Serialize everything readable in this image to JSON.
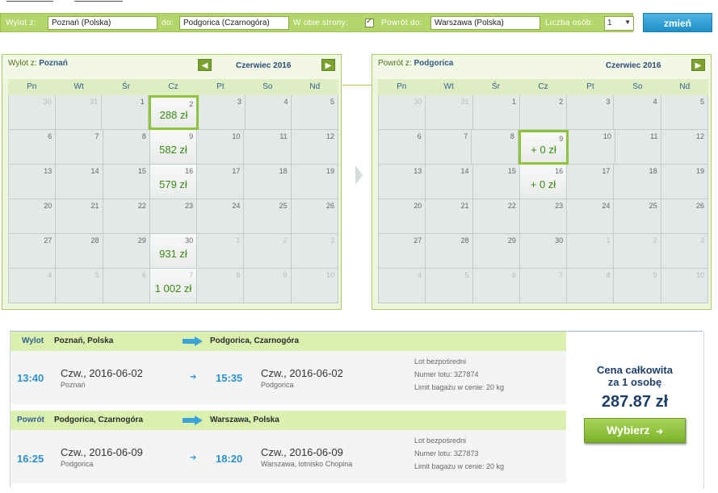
{
  "search": {
    "from_label": "Wylot z:",
    "from_value": "Poznań (Polska)",
    "to_label": "do:",
    "to_value": "Podgorica (Czarnogóra)",
    "roundtrip_label": "W obie strony:",
    "roundtrip_checked": true,
    "return_label": "Powrót do:",
    "return_value": "Warszawa (Polska)",
    "persons_label": "Liczba osób:",
    "persons_value": "1",
    "change_button": "zmień"
  },
  "calendar_out": {
    "title_prefix": "Wylot z:",
    "title_city": "Poznań",
    "month": "Czerwiec 2016",
    "prev_icon": "arrow-left-icon",
    "next_icon": "arrow-right-icon",
    "weekdays": [
      "Pn",
      "Wt",
      "Śr",
      "Cz",
      "Pt",
      "So",
      "Nd"
    ],
    "weeks": [
      [
        {
          "d": "30",
          "out": true
        },
        {
          "d": "31",
          "out": true
        },
        {
          "d": "1"
        },
        {
          "d": "2",
          "price": "288 zł",
          "avail": true,
          "selected": true
        },
        {
          "d": "3"
        },
        {
          "d": "4"
        },
        {
          "d": "5"
        }
      ],
      [
        {
          "d": "6"
        },
        {
          "d": "7"
        },
        {
          "d": "8"
        },
        {
          "d": "9",
          "price": "582 zł",
          "avail": true
        },
        {
          "d": "10"
        },
        {
          "d": "11"
        },
        {
          "d": "12"
        }
      ],
      [
        {
          "d": "13"
        },
        {
          "d": "14"
        },
        {
          "d": "15"
        },
        {
          "d": "16",
          "price": "579 zł",
          "avail": true
        },
        {
          "d": "17"
        },
        {
          "d": "18"
        },
        {
          "d": "19"
        }
      ],
      [
        {
          "d": "20"
        },
        {
          "d": "21"
        },
        {
          "d": "22"
        },
        {
          "d": "23"
        },
        {
          "d": "24"
        },
        {
          "d": "25"
        },
        {
          "d": "26"
        }
      ],
      [
        {
          "d": "27"
        },
        {
          "d": "28"
        },
        {
          "d": "29"
        },
        {
          "d": "30",
          "price": "931 zł",
          "avail": true
        },
        {
          "d": "1",
          "out": true
        },
        {
          "d": "2",
          "out": true
        },
        {
          "d": "3",
          "out": true
        }
      ],
      [
        {
          "d": "4",
          "out": true
        },
        {
          "d": "5",
          "out": true
        },
        {
          "d": "6",
          "out": true
        },
        {
          "d": "7",
          "price": "1 002 zł",
          "avail": true,
          "out": true
        },
        {
          "d": "8",
          "out": true
        },
        {
          "d": "9",
          "out": true
        },
        {
          "d": "10",
          "out": true
        }
      ]
    ]
  },
  "calendar_ret": {
    "title_prefix": "Powrót z:",
    "title_city": "Podgorica",
    "month": "Czerwiec 2016",
    "next_icon": "arrow-right-icon",
    "weekdays": [
      "Pn",
      "Wt",
      "Śr",
      "Cz",
      "Pt",
      "So",
      "Nd"
    ],
    "weeks": [
      [
        {
          "d": "30",
          "out": true
        },
        {
          "d": "31",
          "out": true
        },
        {
          "d": "1"
        },
        {
          "d": "2"
        },
        {
          "d": "3"
        },
        {
          "d": "4"
        },
        {
          "d": "5"
        }
      ],
      [
        {
          "d": "6"
        },
        {
          "d": "7"
        },
        {
          "d": "8"
        },
        {
          "d": "9",
          "price": "+ 0 zł",
          "avail": true,
          "selected": true
        },
        {
          "d": "10"
        },
        {
          "d": "11"
        },
        {
          "d": "12"
        }
      ],
      [
        {
          "d": "13"
        },
        {
          "d": "14"
        },
        {
          "d": "15"
        },
        {
          "d": "16",
          "price": "+ 0 zł",
          "avail": true
        },
        {
          "d": "17"
        },
        {
          "d": "18"
        },
        {
          "d": "19"
        }
      ],
      [
        {
          "d": "20"
        },
        {
          "d": "21"
        },
        {
          "d": "22"
        },
        {
          "d": "23"
        },
        {
          "d": "24"
        },
        {
          "d": "25"
        },
        {
          "d": "26"
        }
      ],
      [
        {
          "d": "27"
        },
        {
          "d": "28"
        },
        {
          "d": "29"
        },
        {
          "d": "30"
        },
        {
          "d": "1",
          "out": true
        },
        {
          "d": "2",
          "out": true
        },
        {
          "d": "3",
          "out": true
        }
      ],
      [
        {
          "d": "4",
          "out": true
        },
        {
          "d": "5",
          "out": true
        },
        {
          "d": "6",
          "out": true
        },
        {
          "d": "7",
          "out": true
        },
        {
          "d": "8",
          "out": true
        },
        {
          "d": "9",
          "out": true
        },
        {
          "d": "10",
          "out": true
        }
      ]
    ]
  },
  "outbound": {
    "label": "Wylot",
    "from_city": "Poznań, Polska",
    "to_city": "Podgorica, Czarnogóra",
    "dep_time": "13:40",
    "dep_date": "Czw., 2016-06-02",
    "dep_place": "Poznań",
    "arr_time": "15:35",
    "arr_date": "Czw., 2016-06-02",
    "arr_place": "Podgorica",
    "info_direct": "Lot bezpośredni",
    "info_flight": "Numer lotu: 3Z7874",
    "info_baggage": "Limit bagażu w cenie: 20 kg"
  },
  "return": {
    "label": "Powrót",
    "from_city": "Podgorica, Czarnogóra",
    "to_city": "Warszawa, Polska",
    "dep_time": "16:25",
    "dep_date": "Czw., 2016-06-09",
    "dep_place": "Podgorica",
    "arr_time": "18:20",
    "arr_date": "Czw., 2016-06-09",
    "arr_place": "Warszawa, lotnisko Chopina",
    "info_direct": "Lot bezpośredni",
    "info_flight": "Numer lotu: 3Z7873",
    "info_baggage": "Limit bagażu w cenie: 20 kg"
  },
  "price": {
    "line1": "Cena całkowita",
    "line2": "za 1 osobę",
    "total": "287.87 zł",
    "button": "Wybierz"
  }
}
